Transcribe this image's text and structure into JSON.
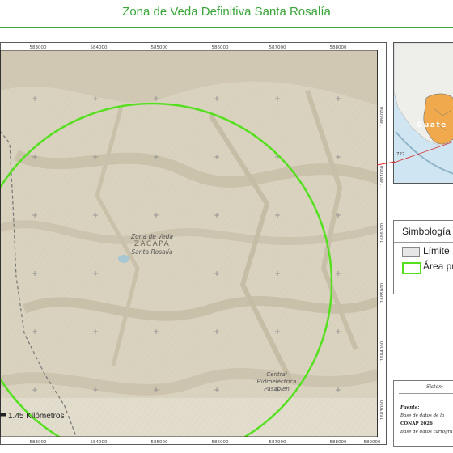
{
  "title": "Zona de Veda Definitiva Santa Rosalía",
  "map": {
    "x_coords": [
      "583000",
      "584000",
      "585000",
      "586000",
      "587000",
      "588000",
      "589000"
    ],
    "y_coords": [
      "1686000",
      "1687000",
      "1686000",
      "1685000",
      "1684000",
      "1683000"
    ],
    "labels": {
      "zona": "Zona de Veda",
      "dept": "ZACAPA",
      "santa": "Santa Rosalía",
      "central1": "Central",
      "central2": "Hidroeléctrica",
      "central3": "Pasabien"
    },
    "scalebar": "1.45 Kilómetros",
    "colors": {
      "terrain": "#d9d2bf",
      "circle": "#55e01f",
      "grid": "#8a8a8a"
    }
  },
  "inset": {
    "label": "Guate",
    "num": "727",
    "colors": {
      "sea": "#cfe5f2",
      "land": "#eeeeea",
      "guatemala": "#f0a94c"
    }
  },
  "legend": {
    "title": "Simbología",
    "items": [
      {
        "label": "Límite",
        "swatch_fill": "#e6e6e6",
        "swatch_stroke": "#888888"
      },
      {
        "label": "Área pr",
        "swatch_fill": "#ffffff",
        "swatch_stroke": "#55e01f"
      }
    ]
  },
  "source": {
    "heading": "Sistem",
    "fuente": "Fuente:",
    "line1": "Base de datos de la",
    "line2": "CONAP 2026",
    "line3": "Base de datos cartogra"
  }
}
